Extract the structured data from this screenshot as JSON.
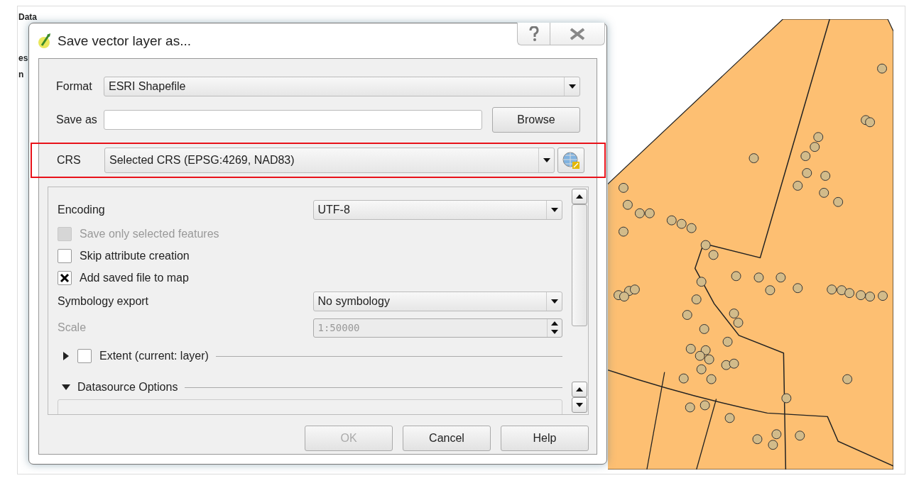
{
  "background_panel": {
    "texts": [
      "Data",
      "es",
      "n"
    ]
  },
  "dialog": {
    "title": "Save vector layer as...",
    "format": {
      "label": "Format",
      "value": "ESRI Shapefile"
    },
    "save_as": {
      "label": "Save as"
    },
    "browse_button": "Browse",
    "crs": {
      "label": "CRS",
      "value": "Selected CRS (EPSG:4269, NAD83)",
      "highlighted": true
    },
    "options": [
      {
        "kind": "combo",
        "label": "Encoding",
        "value": "UTF-8",
        "disabled": false
      },
      {
        "kind": "checkbox",
        "label": "Save only selected features",
        "checked": false,
        "disabled": true
      },
      {
        "kind": "checkbox",
        "label": "Skip attribute creation",
        "checked": false,
        "disabled": false
      },
      {
        "kind": "checkbox",
        "label": "Add saved file to map",
        "checked": true,
        "disabled": false
      },
      {
        "kind": "combo",
        "label": "Symbology export",
        "value": "No symbology",
        "disabled": false
      },
      {
        "kind": "spin",
        "label": "Scale",
        "value": "1:50000",
        "disabled": true
      },
      {
        "kind": "group",
        "label": "Extent (current: layer)",
        "expanded": false,
        "checked": false
      },
      {
        "kind": "group",
        "label": "Datasource Options",
        "expanded": true
      }
    ],
    "buttons": [
      {
        "label": "OK",
        "disabled": true
      },
      {
        "label": "Cancel",
        "disabled": false
      },
      {
        "label": "Help",
        "disabled": false
      }
    ]
  }
}
